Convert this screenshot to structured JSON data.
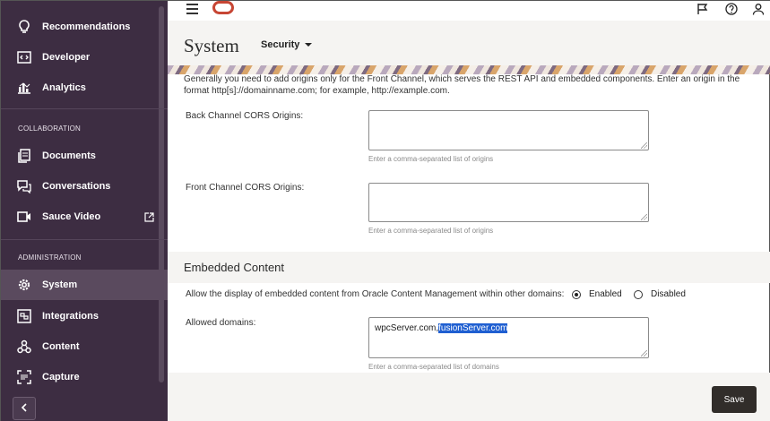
{
  "sidebar": {
    "items": [
      {
        "label": "Recommendations",
        "icon": "lightbulb-icon"
      },
      {
        "label": "Developer",
        "icon": "code-icon"
      },
      {
        "label": "Analytics",
        "icon": "bar-chart-icon"
      },
      {
        "label": "Documents",
        "icon": "documents-icon"
      },
      {
        "label": "Conversations",
        "icon": "conversations-icon"
      },
      {
        "label": "Sauce Video",
        "icon": "video-icon"
      },
      {
        "label": "System",
        "icon": "gear-icon"
      },
      {
        "label": "Integrations",
        "icon": "integrations-icon"
      },
      {
        "label": "Content",
        "icon": "content-icon"
      },
      {
        "label": "Capture",
        "icon": "capture-icon"
      }
    ],
    "sections": {
      "collaboration": "COLLABORATION",
      "administration": "ADMINISTRATION"
    },
    "active": "System"
  },
  "header": {
    "title": "System",
    "section_dropdown": "Security"
  },
  "main": {
    "intro": "Generally you need to add origins only for the Front Channel, which serves the REST API and embedded components. Enter an origin in the format http[s]://domainname.com; for example, http://example.com.",
    "back_channel": {
      "label": "Back Channel CORS Origins:",
      "value": "",
      "help": "Enter a comma-separated list of origins"
    },
    "front_channel": {
      "label": "Front Channel CORS Origins:",
      "value": "",
      "help": "Enter a comma-separated list of origins"
    },
    "embedded": {
      "title": "Embedded Content",
      "allow_label": "Allow the display of embedded content from Oracle Content Management within other domains:",
      "enabled_label": "Enabled",
      "disabled_label": "Disabled",
      "selected": "Enabled",
      "domains_label": "Allowed domains:",
      "domains_value_plain": "wpcServer.com,",
      "domains_value_selected": "fusionServer.com",
      "domains_help": "Enter a comma-separated list of domains"
    },
    "save_label": "Save"
  },
  "colors": {
    "sidebar_bg": "#3d2d42",
    "brand_red": "#c74634",
    "save_bg": "#312d2a",
    "selection": "#1f5fd1"
  }
}
